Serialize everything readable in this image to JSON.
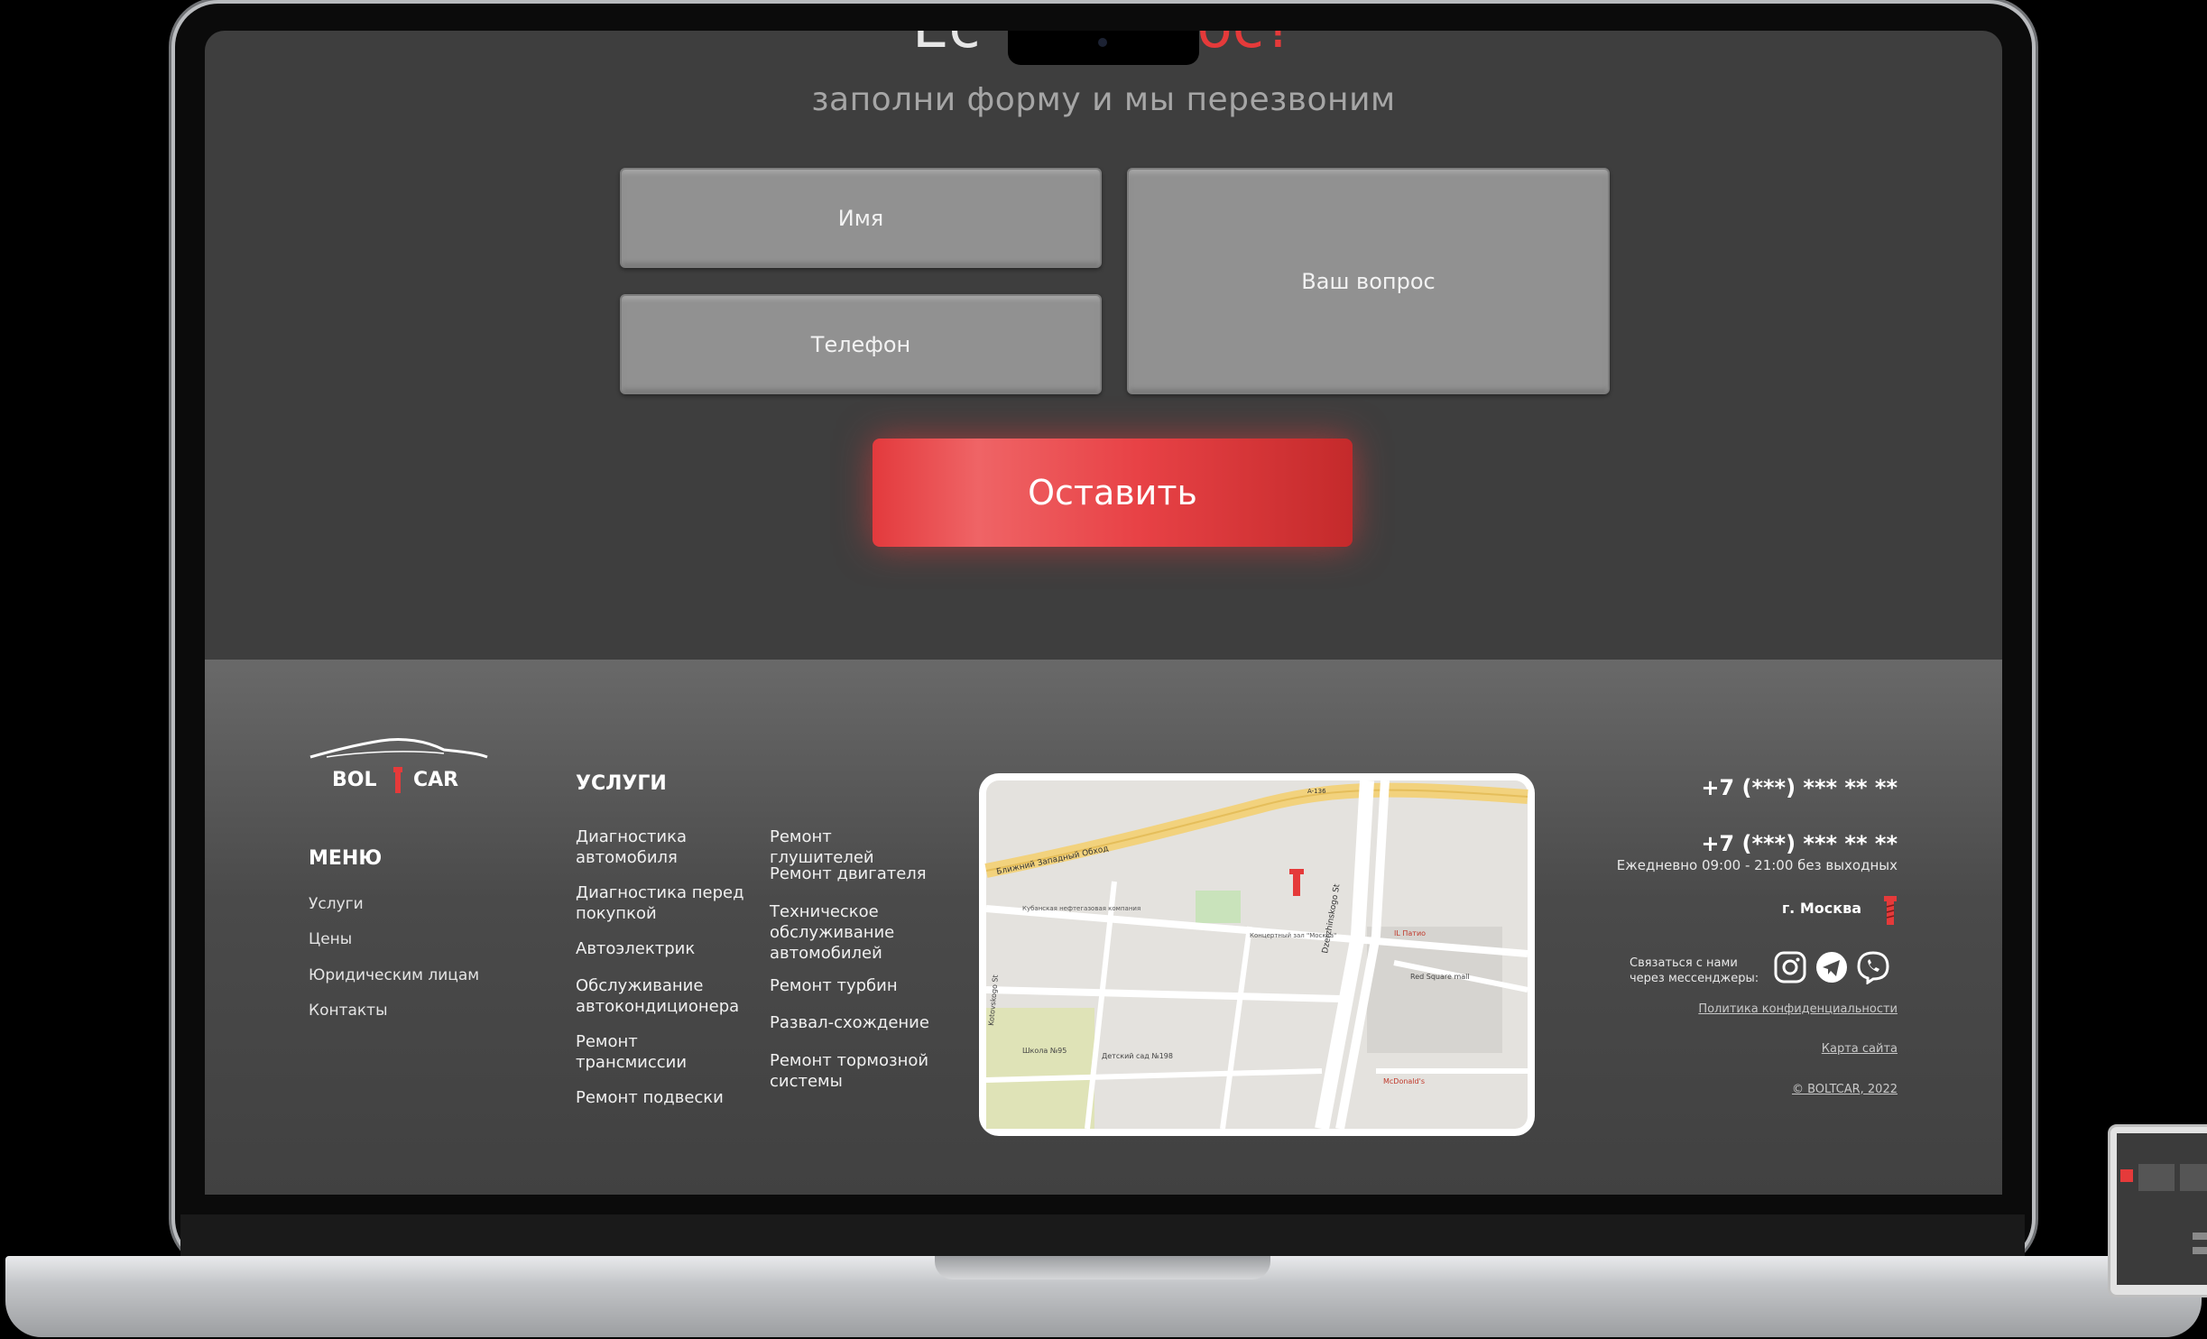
{
  "hero": {
    "title_start": "Ес",
    "title_accent": "ос?",
    "subtitle": "заполни форму и мы перезвоним"
  },
  "form": {
    "name_label": "Имя",
    "phone_label": "Телефон",
    "question_label": "Ваш вопрос",
    "submit_label": "Оставить"
  },
  "footer": {
    "logo": {
      "left": "BOL",
      "right": "CAR",
      "brand": "BOLTCAR"
    },
    "menu_heading": "МЕНЮ",
    "menu_items": [
      "Услуги",
      "Цены",
      "Юридическим лицам",
      "Контакты"
    ],
    "services_heading": "УСЛУГИ",
    "services_col1": [
      "Диагностика автомобиля",
      "Диагностика перед покупкой",
      "Автоэлектрик",
      "Обслуживание автокондиционера",
      "Ремонт трансмиссии",
      "Ремонт подвески"
    ],
    "services_col2": [
      "Ремонт глушителей",
      "Ремонт двигателя",
      "Техническое обслуживание автомобилей",
      "Ремонт турбин",
      "Развал-схождение",
      "Ремонт тормозной системы"
    ],
    "map": {
      "labels": [
        "Ближний Западный Обход",
        "Кубанская нефтегазовая компания",
        "Концертный зал \"Москва\"",
        "Dzerzhinskogo St",
        "IL Патио",
        "Red Square mall",
        "Школа №95",
        "Детский сад №198",
        "McDonald's",
        "Kotovskogo St",
        "A-136"
      ]
    },
    "phone1": "+7 (***) *** ** **",
    "phone2": "+7 (***) *** ** **",
    "hours": "Ежедневно 09:00 - 21:00 без выходных",
    "city": "г. Москва",
    "messenger_label_1": "Связаться с нами",
    "messenger_label_2": "через мессенджеры:",
    "privacy": "Политика конфиденциальности",
    "sitemap": "Карта сайта",
    "copyright": "© BOLTCAR, 2022"
  },
  "colors": {
    "accent": "#e53a3a",
    "page_bg": "#3e3e3e",
    "field_bg": "#919191"
  },
  "icons": [
    "instagram-icon",
    "telegram-icon",
    "viber-icon",
    "bolt-icon",
    "car-silhouette-icon",
    "map-pin-icon"
  ]
}
